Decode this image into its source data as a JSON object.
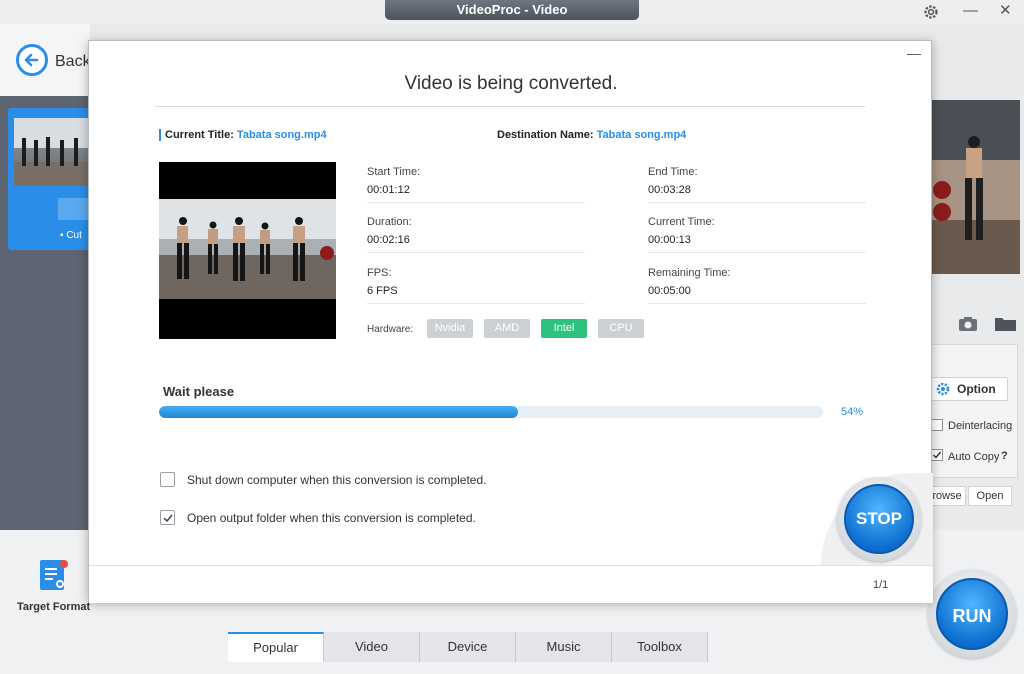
{
  "window": {
    "title": "VideoProc - Video",
    "settings_icon": "gear-icon",
    "minimize_glyph": "—",
    "close_glyph": "✕"
  },
  "background": {
    "back_label": "Back",
    "cut_label": "▪ Cut",
    "option_label": "Option",
    "deinterlacing_label": "Deinterlacing",
    "auto_copy_label": "Auto Copy",
    "auto_copy_help": "?",
    "browse_label": "rowse",
    "open_label": "Open",
    "target_format_label": "Target Format",
    "tabs": [
      "Popular",
      "Video",
      "Device",
      "Music",
      "Toolbox"
    ],
    "run_label": "RUN"
  },
  "dialog": {
    "minimize_glyph": "—",
    "title": "Video is being converted.",
    "current_title_label": "Current Title:",
    "current_title_value": "Tabata song.mp4",
    "destination_label": "Destination Name:",
    "destination_value": "Tabata song.mp4",
    "fields": {
      "start_time": {
        "label": "Start Time:",
        "value": "00:01:12"
      },
      "end_time": {
        "label": "End Time:",
        "value": "00:03:28"
      },
      "duration": {
        "label": "Duration:",
        "value": "00:02:16"
      },
      "current_time": {
        "label": "Current Time:",
        "value": "00:00:13"
      },
      "fps": {
        "label": "FPS:",
        "value": "6 FPS"
      },
      "remaining_time": {
        "label": "Remaining Time:",
        "value": "00:05:00"
      }
    },
    "hardware": {
      "label": "Hardware:",
      "options": [
        "Nvidia",
        "AMD",
        "Intel",
        "CPU"
      ],
      "active": "Intel"
    },
    "wait_label": "Wait please",
    "progress_percent": 54,
    "progress_text": "54%",
    "shutdown_label": "Shut down computer when this conversion is completed.",
    "shutdown_checked": false,
    "open_folder_label": "Open output folder when this conversion is completed.",
    "open_folder_checked": true,
    "stop_label": "STOP",
    "page_count": "1/1"
  },
  "colors": {
    "accent": "#2a8ee8",
    "hardware_active": "#2ec27e",
    "hardware_inactive": "#cdd0d3"
  }
}
